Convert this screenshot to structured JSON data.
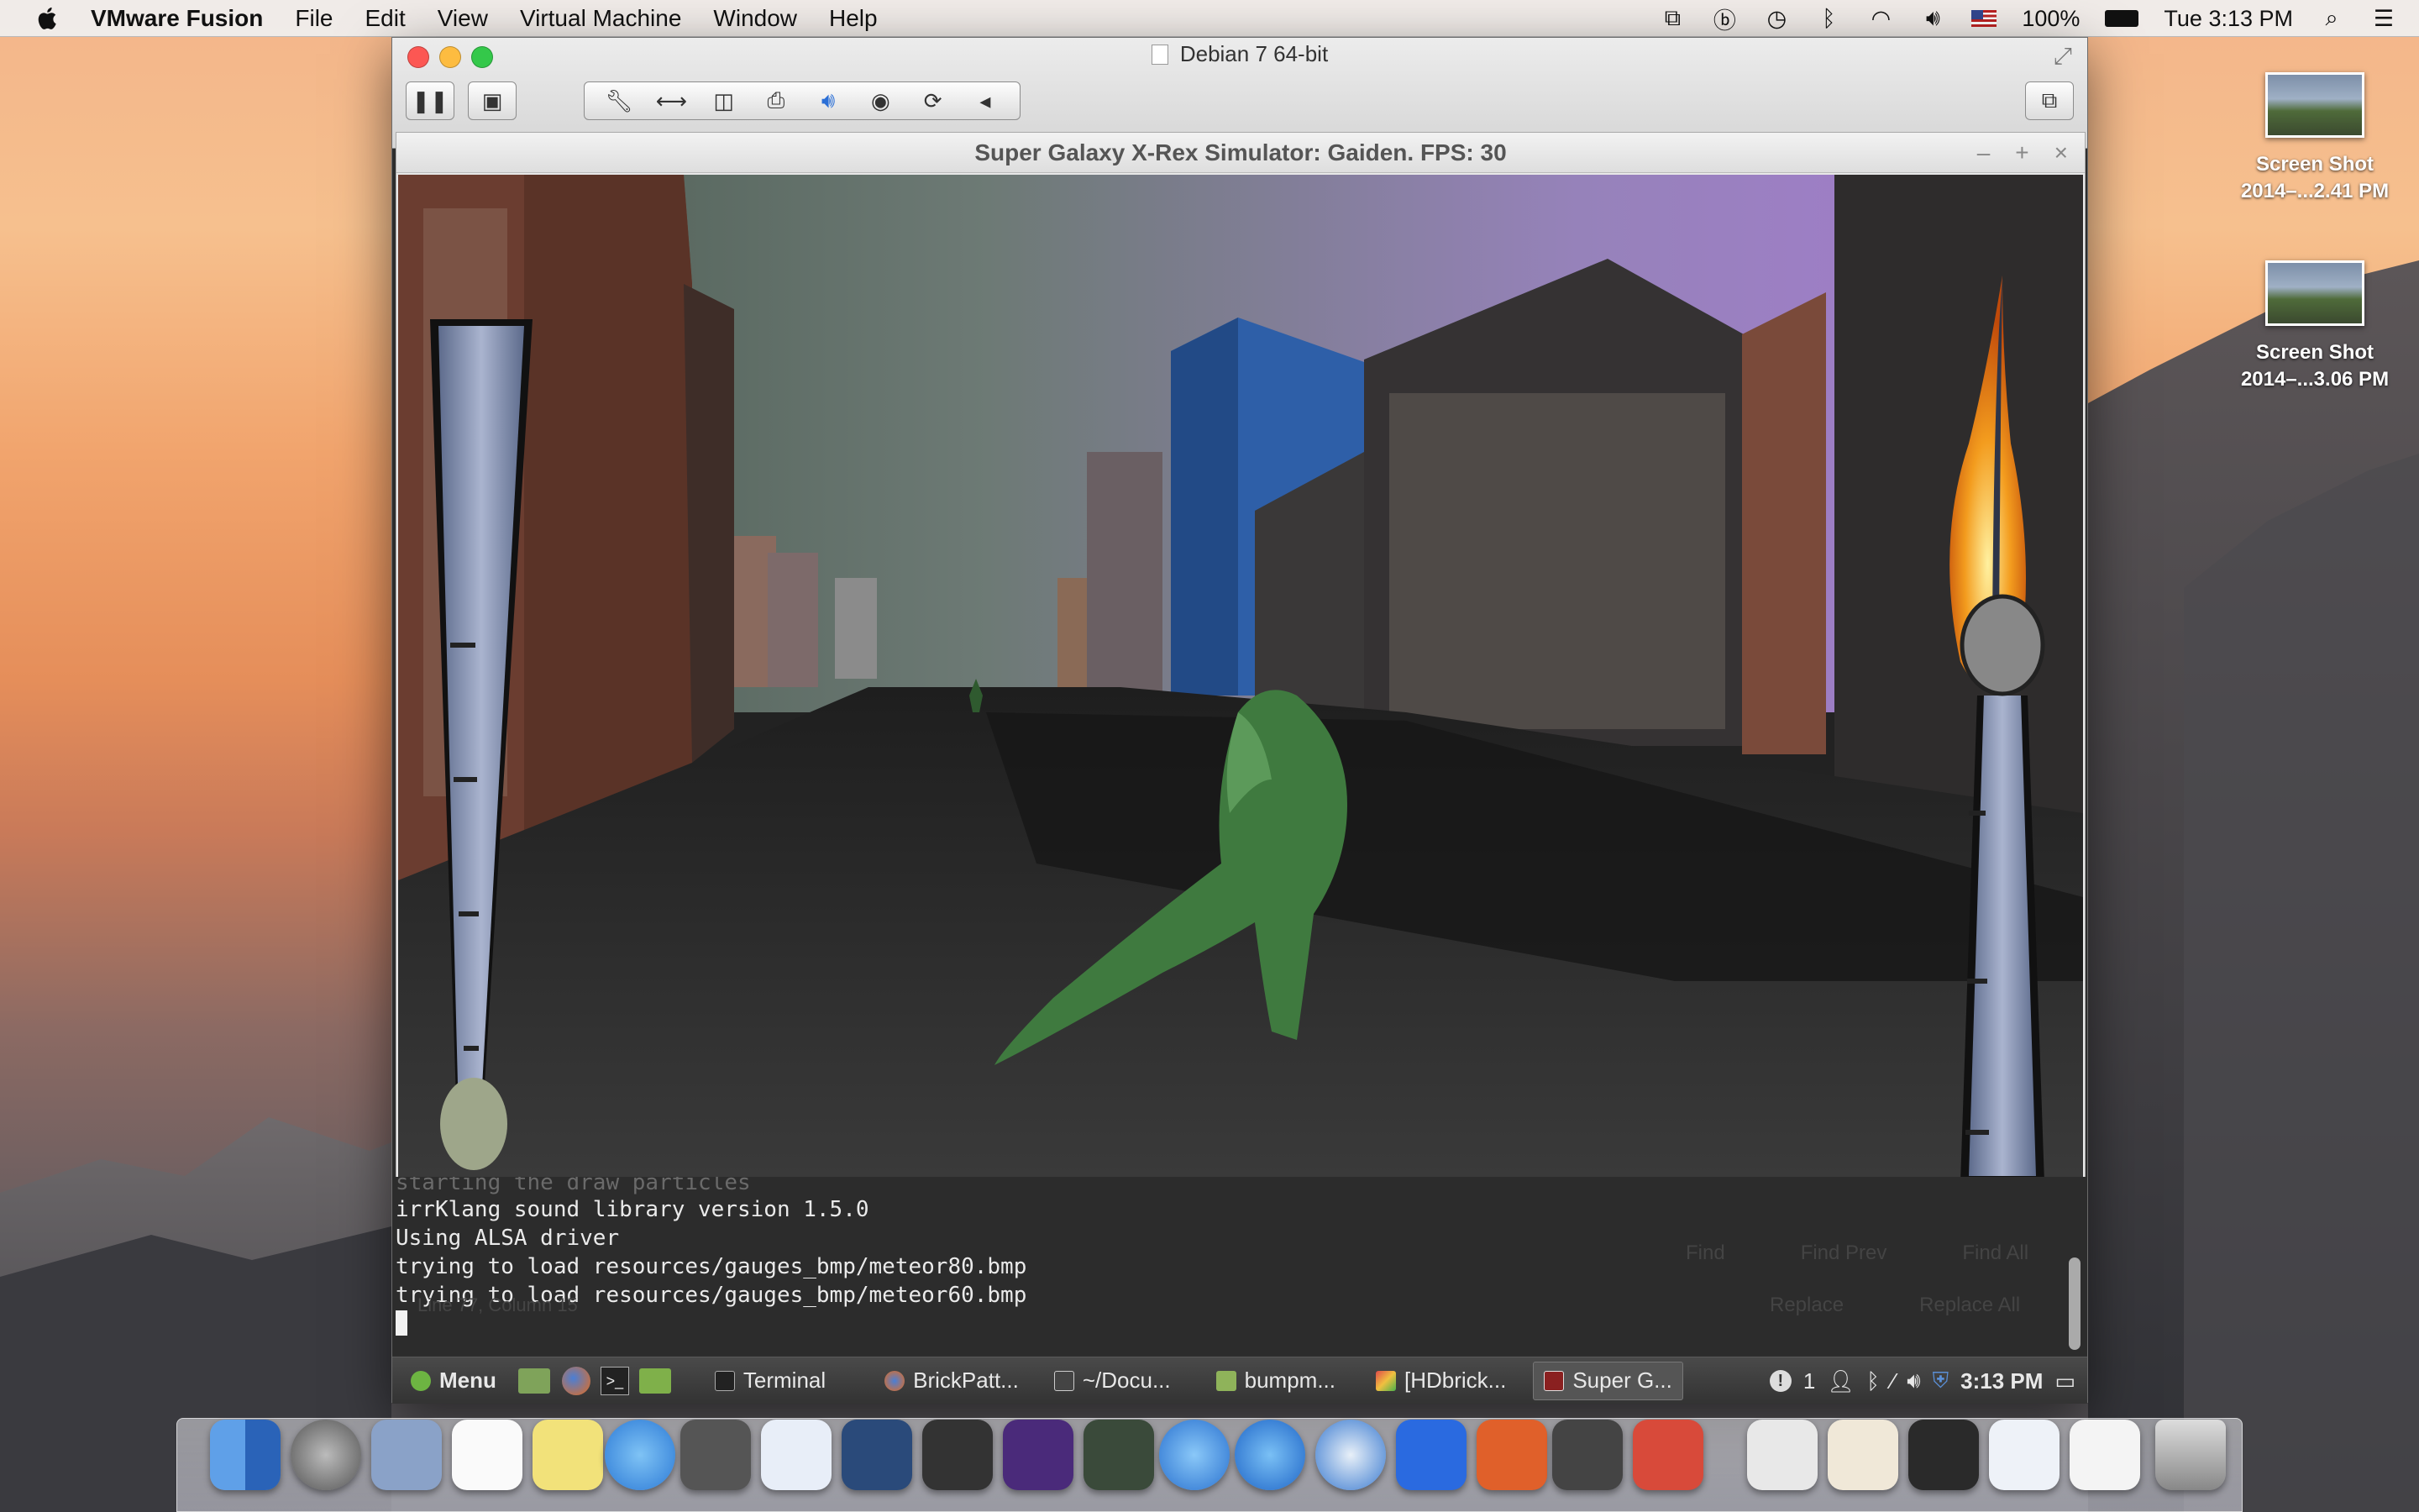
{
  "menubar": {
    "app_name": "VMware Fusion",
    "menus": [
      "File",
      "Edit",
      "View",
      "Virtual Machine",
      "Window",
      "Help"
    ],
    "battery": "100%",
    "clock": "Tue 3:13 PM"
  },
  "desktop": {
    "icons": [
      {
        "line1": "Screen Shot",
        "line2": "2014–...2.41 PM"
      },
      {
        "line1": "Screen Shot",
        "line2": "2014–...3.06 PM"
      }
    ]
  },
  "vm_window": {
    "title": "Debian 7 64-bit"
  },
  "game_window": {
    "title": "Super Galaxy X-Rex Simulator: Gaiden. FPS: 30",
    "controls": [
      "–",
      "+",
      "×"
    ]
  },
  "terminal": {
    "lines": [
      "starting the draw particles",
      "irrKlang sound library version 1.5.0",
      "Using ALSA driver",
      "trying to load resources/gauges_bmp/meteor80.bmp",
      "trying to load resources/gauges_bmp/meteor60.bmp"
    ],
    "ghost_bottom": [
      "Find",
      "Find Prev",
      "Find All",
      "Replace",
      "Replace All"
    ],
    "ghost_status": "Line 77, Column 15"
  },
  "linux_panel": {
    "menu_label": "Menu",
    "tasks": [
      "Terminal",
      "BrickPatt...",
      "~/Docu...",
      "bumpm...",
      "[HDbrick...",
      "Super G..."
    ],
    "tray_count": "1",
    "clock": "3:13 PM"
  },
  "colors": {
    "sky_purple": "#a47bcf",
    "asphalt": "#2a2a2a",
    "dino_green": "#3f7a3f",
    "gauge_blue": "#7d8aa8"
  }
}
